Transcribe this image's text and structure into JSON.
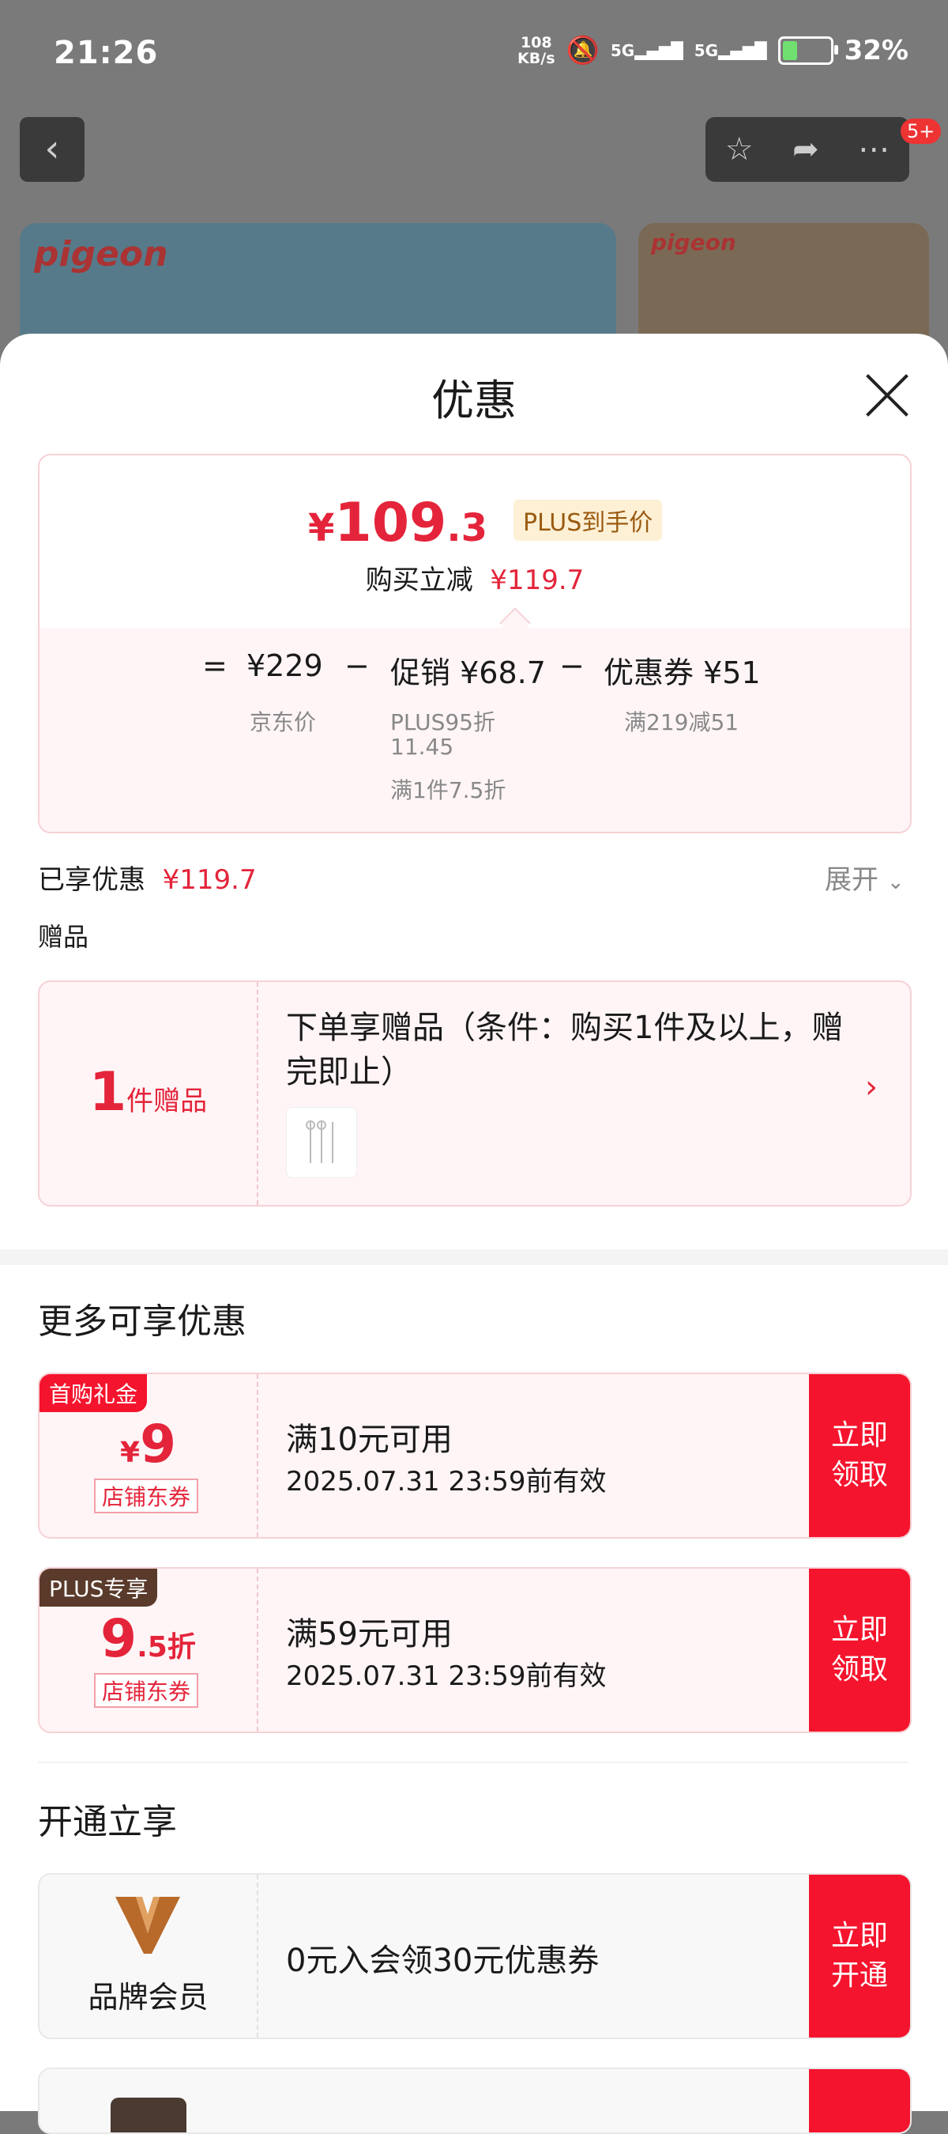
{
  "status_bar": {
    "time": "21:26",
    "speed_value": "108",
    "speed_unit": "KB/s",
    "net1": "5G",
    "net2": "5G",
    "battery": "32%",
    "battery_level": 0.32
  },
  "header": {
    "badge": "5+"
  },
  "banner": {
    "logo1": "pigeon",
    "logo2": "pigeon"
  },
  "sheet": {
    "title": "优惠",
    "price_card": {
      "currency": "¥",
      "price_int": "109",
      "price_dec": ".3",
      "plus_tag": "PLUS到手价",
      "sub_label": "购买立减",
      "sub_value": "¥119.7",
      "eq": "=",
      "minus": "−",
      "base_value": "¥229",
      "base_label": "京东价",
      "promo_label": "促销",
      "promo_value": "¥68.7",
      "promo_note1": "PLUS95折",
      "promo_note2": "11.45",
      "promo_note3": "满1件7.5折",
      "coupon_label": "优惠券",
      "coupon_value": "¥51",
      "coupon_note": "满219减51"
    },
    "enjoyed_label": "已享优惠",
    "enjoyed_value": "¥119.7",
    "expand": "展开",
    "gift_section": "赠品",
    "gift": {
      "count": "1",
      "count_unit": "件赠品",
      "text": "下单享赠品（条件：购买1件及以上，赠完即止）",
      "arrow": "›"
    },
    "more_title": "更多可享优惠",
    "coupons": [
      {
        "tag": "首购礼金",
        "symbol": "¥",
        "value": "9",
        "suffix": "",
        "type": "店铺东券",
        "condition": "满10元可用",
        "expire": "2025.07.31 23:59前有效",
        "button": "立即领取",
        "tag_color": "#f5142d"
      },
      {
        "tag": "PLUS专享",
        "symbol": "",
        "value": "9",
        "suffix": ".5折",
        "type": "店铺东券",
        "condition": "满59元可用",
        "expire": "2025.07.31 23:59前有效",
        "button": "立即领取",
        "tag_color": "#5a3a2a"
      }
    ],
    "member_title": "开通立享",
    "member": {
      "label": "品牌会员",
      "text": "0元入会领30元优惠券",
      "button": "立即开通"
    }
  }
}
